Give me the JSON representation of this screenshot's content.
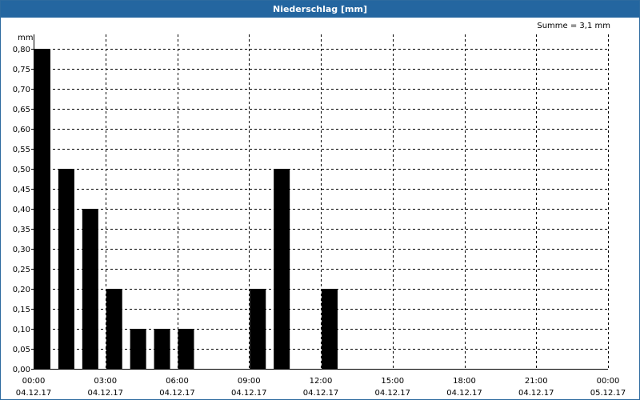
{
  "window": {
    "title": "Niederschlag [mm]"
  },
  "summary": {
    "text": "Summe = 3,1 mm"
  },
  "chart_data": {
    "type": "bar",
    "title": "Niederschlag [mm]",
    "ylabel": "mm",
    "ylim": [
      0,
      0.8
    ],
    "ytick_step": 0.05,
    "ytick_labels": [
      "0,00",
      "0,05",
      "0,10",
      "0,15",
      "0,20",
      "0,25",
      "0,30",
      "0,35",
      "0,40",
      "0,45",
      "0,50",
      "0,55",
      "0,60",
      "0,65",
      "0,70",
      "0,75",
      "0,80"
    ],
    "x_unit": "hour",
    "xlim": [
      0,
      24
    ],
    "xticks": [
      {
        "x": 0,
        "time": "00:00",
        "date": "04.12.17"
      },
      {
        "x": 3,
        "time": "03:00",
        "date": "04.12.17"
      },
      {
        "x": 6,
        "time": "06:00",
        "date": "04.12.17"
      },
      {
        "x": 9,
        "time": "09:00",
        "date": "04.12.17"
      },
      {
        "x": 12,
        "time": "12:00",
        "date": "04.12.17"
      },
      {
        "x": 15,
        "time": "15:00",
        "date": "04.12.17"
      },
      {
        "x": 18,
        "time": "18:00",
        "date": "04.12.17"
      },
      {
        "x": 21,
        "time": "21:00",
        "date": "04.12.17"
      },
      {
        "x": 24,
        "time": "00:00",
        "date": "05.12.17"
      }
    ],
    "series": [
      {
        "color": "#000000",
        "points": [
          {
            "hour": 0,
            "value": 0.8
          },
          {
            "hour": 1,
            "value": 0.5
          },
          {
            "hour": 2,
            "value": 0.4
          },
          {
            "hour": 3,
            "value": 0.2
          },
          {
            "hour": 4,
            "value": 0.1
          },
          {
            "hour": 5,
            "value": 0.1
          },
          {
            "hour": 6,
            "value": 0.1
          },
          {
            "hour": 9,
            "value": 0.2
          },
          {
            "hour": 10,
            "value": 0.5
          },
          {
            "hour": 12,
            "value": 0.2
          }
        ]
      }
    ],
    "grid": true,
    "sum_label": "Summe = 3,1 mm"
  }
}
